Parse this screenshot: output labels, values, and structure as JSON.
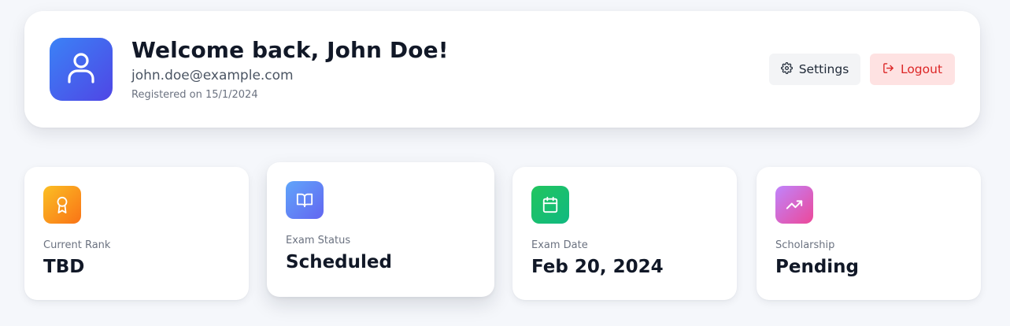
{
  "user": {
    "welcome": "Welcome back, John Doe!",
    "email": "john.doe@example.com",
    "registered": "Registered on 15/1/2024"
  },
  "actions": {
    "settings_label": "Settings",
    "logout_label": "Logout"
  },
  "stats": [
    {
      "label": "Current Rank",
      "value": "TBD",
      "icon": "award-icon",
      "gradient": [
        "#f59e0b",
        "#f97316"
      ]
    },
    {
      "label": "Exam Status",
      "value": "Scheduled",
      "icon": "book-open-icon",
      "gradient": [
        "#3b82f6",
        "#6366f1"
      ]
    },
    {
      "label": "Exam Date",
      "value": "Feb 20, 2024",
      "icon": "calendar-icon",
      "gradient": [
        "#22c55e",
        "#16a34a"
      ]
    },
    {
      "label": "Scholarship",
      "value": "Pending",
      "icon": "trending-up-icon",
      "gradient": [
        "#a855f7",
        "#ec4899"
      ]
    }
  ],
  "colors": {
    "avatar_gradient": [
      "#3b82f6",
      "#4f46e5"
    ],
    "logout_bg": "#fee2e2",
    "logout_text": "#dc2626",
    "settings_bg": "#f3f4f6",
    "page_bg": "#f5f7fb"
  }
}
